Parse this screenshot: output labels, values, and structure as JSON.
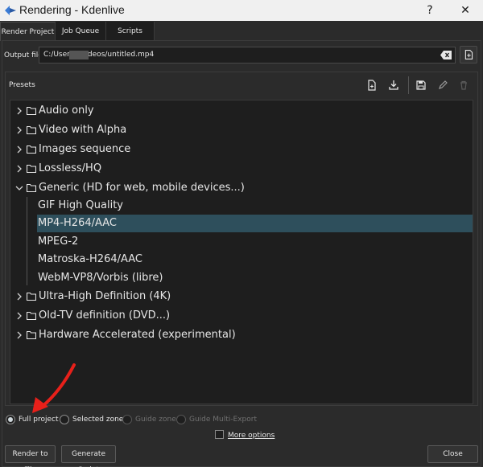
{
  "window": {
    "title": "Rendering - Kdenlive",
    "help_symbol": "?",
    "close_symbol": "✕"
  },
  "tabs": [
    {
      "label": "Render Project",
      "active": true
    },
    {
      "label": "Job Queue",
      "active": false
    },
    {
      "label": "Scripts",
      "active": false
    }
  ],
  "output": {
    "label": "Output file",
    "value": "C:/Users/        /Videos/untitled.mp4"
  },
  "presets": {
    "label": "Presets",
    "items": [
      {
        "label": "Audio only",
        "type": "folder",
        "expanded": false
      },
      {
        "label": "Video with Alpha",
        "type": "folder",
        "expanded": false
      },
      {
        "label": "Images sequence",
        "type": "folder",
        "expanded": false
      },
      {
        "label": "Lossless/HQ",
        "type": "folder",
        "expanded": false
      },
      {
        "label": "Generic (HD for web, mobile devices...)",
        "type": "folder",
        "expanded": true
      },
      {
        "label": "GIF High Quality",
        "type": "preset"
      },
      {
        "label": "MP4-H264/AAC",
        "type": "preset",
        "selected": true
      },
      {
        "label": "MPEG-2",
        "type": "preset"
      },
      {
        "label": "Matroska-H264/AAC",
        "type": "preset"
      },
      {
        "label": "WebM-VP8/Vorbis (libre)",
        "type": "preset"
      },
      {
        "label": "Ultra-High Definition (4K)",
        "type": "folder",
        "expanded": false
      },
      {
        "label": "Old-TV definition (DVD...)",
        "type": "folder",
        "expanded": false
      },
      {
        "label": "Hardware Accelerated (experimental)",
        "type": "folder",
        "expanded": false
      }
    ]
  },
  "range": {
    "options": [
      {
        "label": "Full project",
        "checked": true,
        "enabled": true
      },
      {
        "label": "Selected zone",
        "checked": false,
        "enabled": true
      },
      {
        "label": "Guide zone",
        "checked": false,
        "enabled": false
      },
      {
        "label": "Guide Multi-Export",
        "checked": false,
        "enabled": false
      }
    ]
  },
  "more_options": {
    "label": "More options",
    "checked": false
  },
  "buttons": {
    "render": "Render to File",
    "script": "Generate Script",
    "close": "Close"
  },
  "colors": {
    "background": "#2b2b2b",
    "tree_background": "#1e1e1e",
    "selection": "#2e4f5c",
    "annotation_arrow": "#e8201a"
  }
}
